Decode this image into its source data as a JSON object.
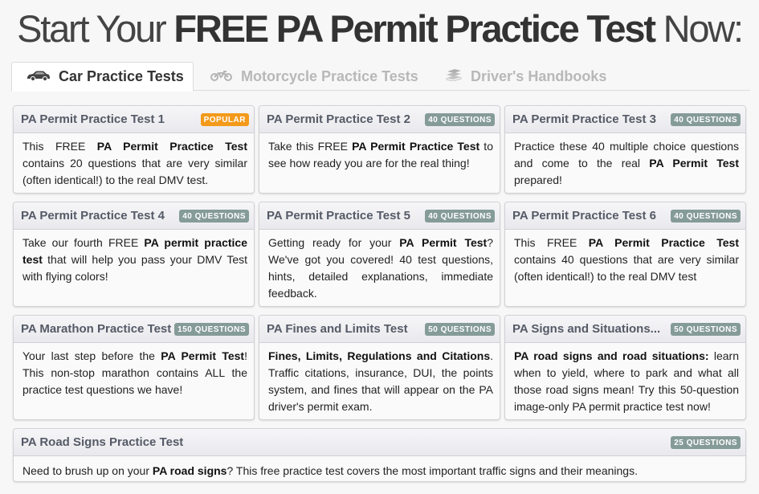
{
  "headline": {
    "prefix": "Start Your",
    "emphasis": "FREE PA Permit Practice Test",
    "suffix": "Now:"
  },
  "tabs": [
    {
      "label": "Car Practice Tests",
      "icon": "car-icon",
      "active": true
    },
    {
      "label": "Motorcycle Practice Tests",
      "icon": "motorcycle-icon",
      "active": false
    },
    {
      "label": "Driver's Handbooks",
      "icon": "books-icon",
      "active": false
    }
  ],
  "colors": {
    "badge_default": "#859b97",
    "badge_popular": "#f39a1a",
    "card_title": "#555a66"
  },
  "cards": [
    {
      "title": "PA Permit Practice Test 1",
      "badge": "POPULAR",
      "body": [
        {
          "t": "This FREE "
        },
        {
          "b": "PA Permit Practice Test"
        },
        {
          "t": " contains 20 questions that are very similar (often identical!) to the real DMV test."
        }
      ]
    },
    {
      "title": "PA Permit Practice Test 2",
      "badge": "40 QUESTIONS",
      "body": [
        {
          "t": "Take this FREE "
        },
        {
          "b": "PA Permit Practice Test"
        },
        {
          "t": " to see how ready you are for the real thing!"
        }
      ]
    },
    {
      "title": "PA Permit Practice Test 3",
      "badge": "40 QUESTIONS",
      "body": [
        {
          "t": "Practice these 40 multiple choice questions and come to the real "
        },
        {
          "b": "PA Permit Test"
        },
        {
          "t": " prepared!"
        }
      ]
    },
    {
      "title": "PA Permit Practice Test 4",
      "badge": "40 QUESTIONS",
      "body": [
        {
          "t": "Take our fourth FREE "
        },
        {
          "b": "PA permit practice test"
        },
        {
          "t": " that will help you pass your DMV Test with flying colors!"
        }
      ]
    },
    {
      "title": "PA Permit Practice Test 5",
      "badge": "40 QUESTIONS",
      "body": [
        {
          "t": "Getting ready for your "
        },
        {
          "b": "PA Permit Test"
        },
        {
          "t": "? We've got you covered! 40 test questions, hints, detailed explanations, immediate feedback."
        }
      ]
    },
    {
      "title": "PA Permit Practice Test 6",
      "badge": "40 QUESTIONS",
      "body": [
        {
          "t": "This FREE "
        },
        {
          "b": "PA Permit Practice Test"
        },
        {
          "t": " contains 40 questions that are very similar (often identical!) to the real DMV test"
        }
      ]
    },
    {
      "title": "PA Marathon Practice Test",
      "badge": "150 QUESTIONS",
      "body": [
        {
          "t": "Your last step before the "
        },
        {
          "b": "PA Permit Test"
        },
        {
          "t": "! This non-stop marathon contains ALL the practice test questions we have!"
        }
      ]
    },
    {
      "title": "PA Fines and Limits Test",
      "badge": "50 QUESTIONS",
      "body": [
        {
          "b": "Fines, Limits, Regulations and Citations"
        },
        {
          "t": ". Traffic citations, insurance, DUI, the points system, and fines that will appear on the PA driver's permit exam."
        }
      ]
    },
    {
      "title": "PA Signs and Situations...",
      "badge": "50 QUESTIONS",
      "body": [
        {
          "b": "PA road signs and road situations:"
        },
        {
          "t": " learn when to yield, where to park and what all those road signs mean! Try this 50-question image-only PA permit practice test now!"
        }
      ]
    },
    {
      "title": "PA Road Signs Practice Test",
      "badge": "25 QUESTIONS",
      "body": [
        {
          "t": "Need to brush up on your "
        },
        {
          "b": "PA road signs"
        },
        {
          "t": "? This free practice test covers the most important traffic signs and their meanings."
        }
      ]
    }
  ]
}
